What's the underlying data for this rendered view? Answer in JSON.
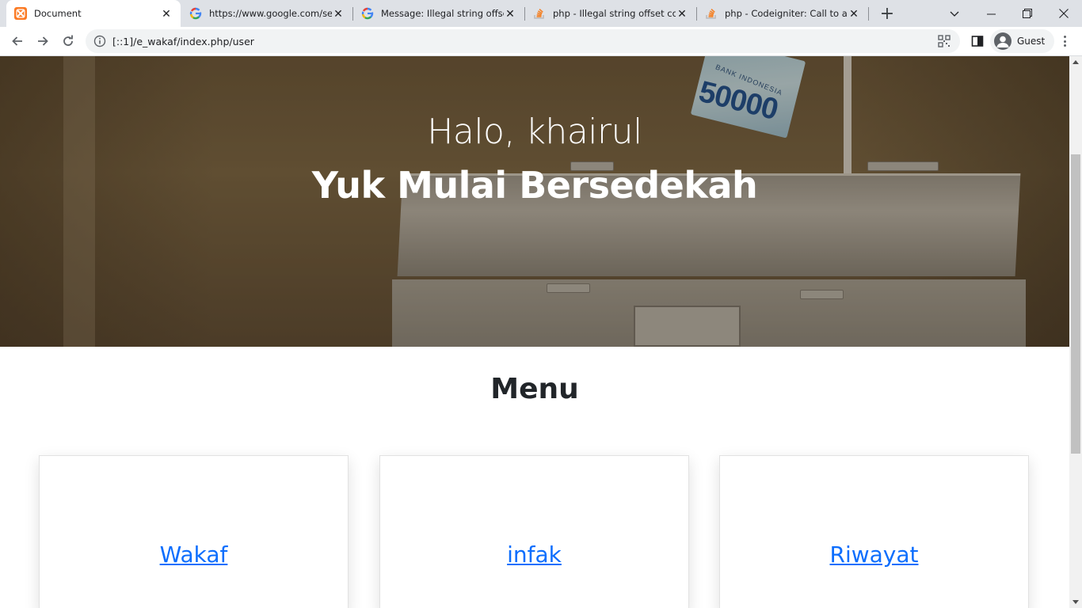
{
  "browser": {
    "tabs": [
      {
        "title": "Document",
        "icon": "xampp-icon"
      },
      {
        "title": "https://www.google.com/sea",
        "icon": "google-icon"
      },
      {
        "title": "Message: Illegal string offset",
        "icon": "google-icon"
      },
      {
        "title": "php - Illegal string offset cod",
        "icon": "stackoverflow-icon"
      },
      {
        "title": "php - Codeigniter: Call to a m",
        "icon": "stackoverflow-icon"
      }
    ],
    "new_tab_label": "+",
    "address": "[::1]/e_wakaf/index.php/user",
    "profile_label": "Guest"
  },
  "hero": {
    "greeting": "Halo, khairul",
    "headline": "Yuk Mulai Bersedekah",
    "banknote_bank": "BANK INDONESIA",
    "banknote_amount": "50000"
  },
  "menu": {
    "title": "Menu",
    "items": [
      {
        "label": "Wakaf"
      },
      {
        "label": "infak"
      },
      {
        "label": "Riwayat"
      }
    ]
  },
  "colors": {
    "link": "#0d6efd",
    "tabbar": "#dee1e6",
    "heading": "#212529"
  }
}
